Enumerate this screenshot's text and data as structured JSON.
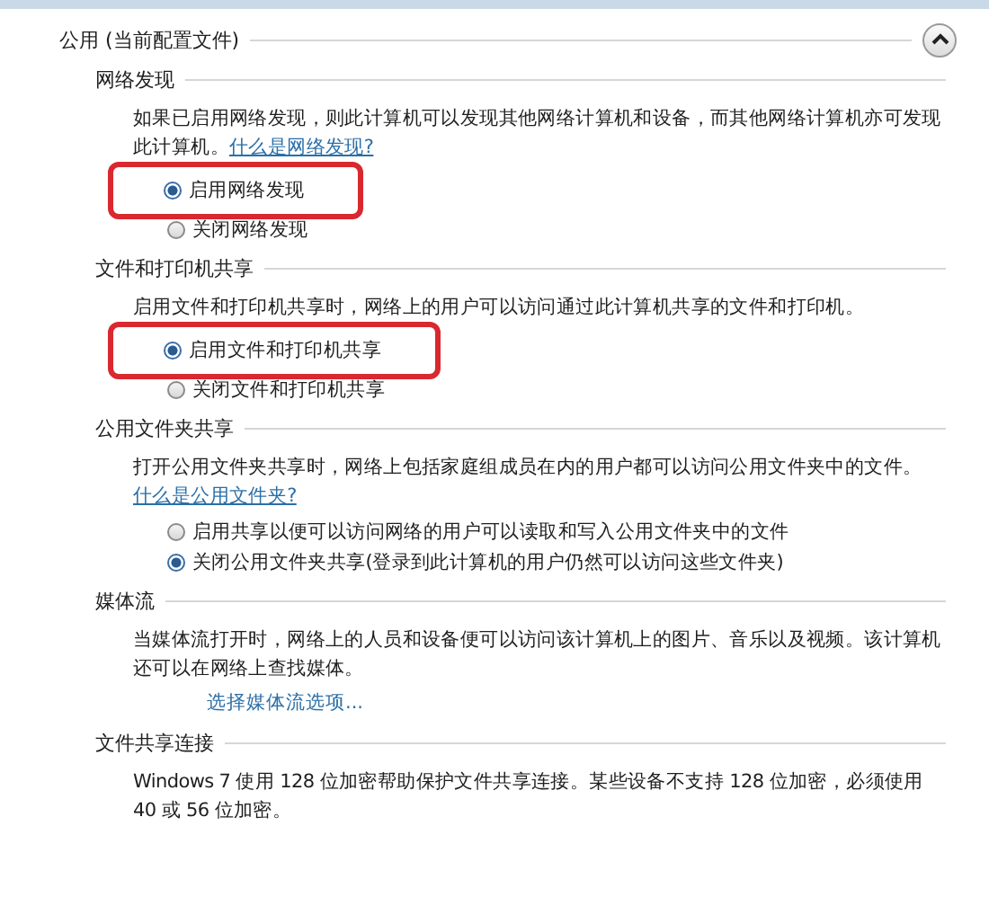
{
  "group": {
    "title": "公用 (当前配置文件)",
    "expanded": true
  },
  "sections": [
    {
      "title": "网络发现",
      "description": "如果已启用网络发现，则此计算机可以发现其他网络计算机和设备，而其他网络计算机亦可发现此计算机。",
      "link": "什么是网络发现?",
      "options": [
        {
          "label": "启用网络发现",
          "selected": true,
          "highlighted": true
        },
        {
          "label": "关闭网络发现",
          "selected": false,
          "highlighted": false
        }
      ]
    },
    {
      "title": "文件和打印机共享",
      "description": "启用文件和打印机共享时，网络上的用户可以访问通过此计算机共享的文件和打印机。",
      "options": [
        {
          "label": "启用文件和打印机共享",
          "selected": true,
          "highlighted": true
        },
        {
          "label": "关闭文件和打印机共享",
          "selected": false,
          "highlighted": false
        }
      ]
    },
    {
      "title": "公用文件夹共享",
      "description": "打开公用文件夹共享时，网络上包括家庭组成员在内的用户都可以访问公用文件夹中的文件。",
      "link": "什么是公用文件夹?",
      "options": [
        {
          "label": "启用共享以便可以访问网络的用户可以读取和写入公用文件夹中的文件",
          "selected": false,
          "highlighted": false
        },
        {
          "label": "关闭公用文件夹共享(登录到此计算机的用户仍然可以访问这些文件夹)",
          "selected": true,
          "highlighted": false
        }
      ]
    },
    {
      "title": "媒体流",
      "description": "当媒体流打开时，网络上的人员和设备便可以访问该计算机上的图片、音乐以及视频。该计算机还可以在网络上查找媒体。",
      "action_link": "选择媒体流选项..."
    },
    {
      "title": "文件共享连接",
      "description": "Windows 7 使用 128 位加密帮助保护文件共享连接。某些设备不支持 128 位加密，必须使用 40 或 56 位加密。"
    }
  ]
}
